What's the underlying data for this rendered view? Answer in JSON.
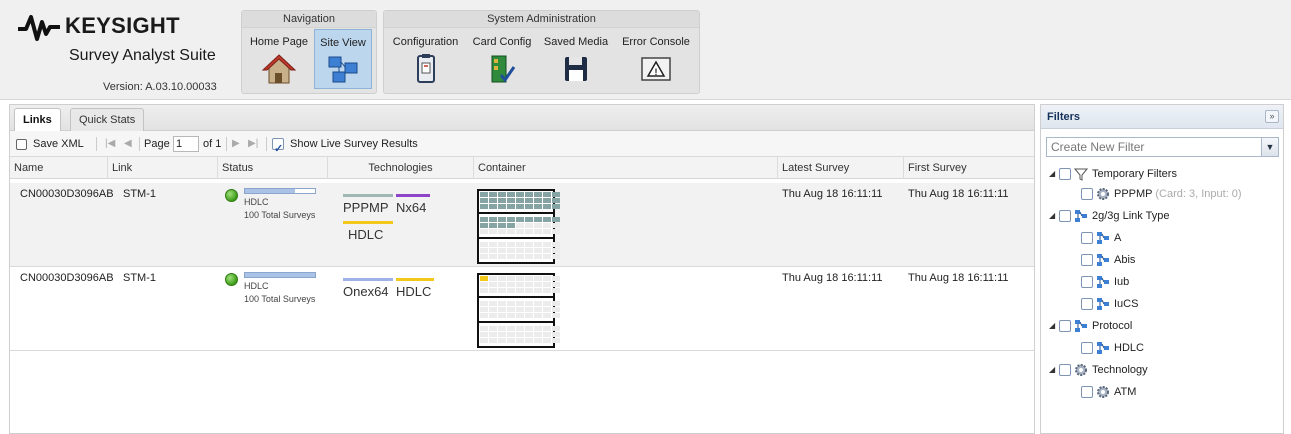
{
  "app": {
    "brand": "KEYSIGHT",
    "suite": "Survey Analyst Suite",
    "version": "Version: A.03.10.00033"
  },
  "nav": {
    "navigation_title": "Navigation",
    "sysadmin_title": "System Administration",
    "buttons": [
      {
        "label": "Home Page",
        "icon": "house-icon"
      },
      {
        "label": "Site View",
        "icon": "site-view-icon",
        "active": true
      },
      {
        "label": "Configuration",
        "icon": "clipboard-icon"
      },
      {
        "label": "Card Config",
        "icon": "card-config-icon"
      },
      {
        "label": "Saved Media",
        "icon": "floppy-disk-icon"
      },
      {
        "label": "Error Console",
        "icon": "warning-icon"
      }
    ]
  },
  "tabs": [
    {
      "label": "Links",
      "active": true
    },
    {
      "label": "Quick Stats"
    }
  ],
  "toolbar": {
    "save_xml": "Save XML",
    "page_label": "Page",
    "page_value": "1",
    "of_pages": "of 1",
    "show_live": "Show Live Survey Results",
    "show_live_checked": true
  },
  "table": {
    "columns": [
      "Name",
      "Link",
      "Status",
      "Technologies",
      "Container",
      "Latest Survey",
      "First Survey"
    ],
    "rows": [
      {
        "name": "CN00030D3096AB",
        "link": "STM-1",
        "status_type": "HDLC",
        "status_count": "100 Total Surveys",
        "status_progress": 0.72,
        "tech": [
          {
            "label": "PPPMP",
            "color": "#9fb8b4"
          },
          {
            "label": "Nx64",
            "color": "#8e44c8"
          },
          {
            "label": "HDLC",
            "color": "#f2c81b"
          }
        ],
        "latest": "Thu Aug 18 16:11:11",
        "first": "Thu Aug 18 16:11:11"
      },
      {
        "name": "CN00030D3096AB",
        "link": "STM-1",
        "status_type": "HDLC",
        "status_count": "100 Total Surveys",
        "status_progress": 1.0,
        "tech": [
          {
            "label": "Onex64",
            "color": "#9fb2e8"
          },
          {
            "label": "HDLC",
            "color": "#f2c81b"
          }
        ],
        "latest": "Thu Aug 18 16:11:11",
        "first": "Thu Aug 18 16:11:11"
      }
    ]
  },
  "filters": {
    "title": "Filters",
    "collapse": "»",
    "placeholder": "Create New Filter",
    "tree": [
      {
        "label": "Temporary Filters",
        "icon": "funnel-icon",
        "level": 0,
        "expanded": true
      },
      {
        "label": "PPPMP",
        "extra": "(Card: 3, Input: 0)",
        "icon": "gear-icon",
        "level": 1
      },
      {
        "label": "2g/3g Link Type",
        "icon": "link-type-icon",
        "level": 0,
        "expanded": true
      },
      {
        "label": "A",
        "icon": "link-type-icon",
        "level": 1
      },
      {
        "label": "Abis",
        "icon": "link-type-icon",
        "level": 1
      },
      {
        "label": "Iub",
        "icon": "link-type-icon",
        "level": 1
      },
      {
        "label": "IuCS",
        "icon": "link-type-icon",
        "level": 1
      },
      {
        "label": "Protocol",
        "icon": "link-type-icon",
        "level": 0,
        "expanded": true
      },
      {
        "label": "HDLC",
        "icon": "link-type-icon",
        "level": 1
      },
      {
        "label": "Technology",
        "icon": "gear-icon",
        "level": 0,
        "expanded": true
      },
      {
        "label": "ATM",
        "icon": "gear-icon",
        "level": 1
      }
    ]
  }
}
